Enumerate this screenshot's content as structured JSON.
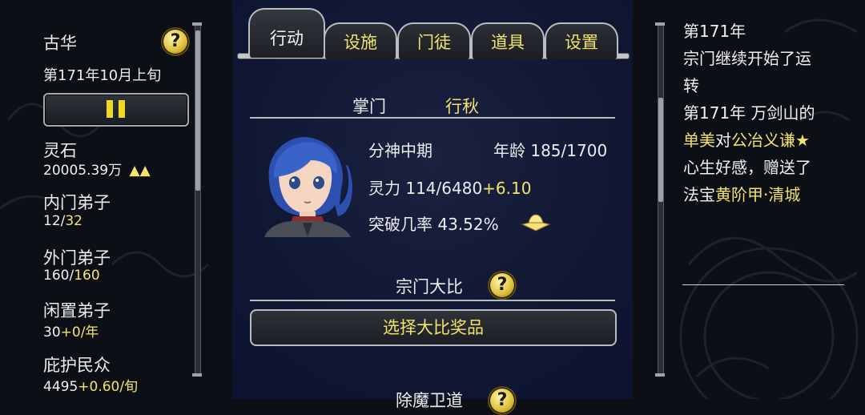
{
  "sidebar": {
    "sect_name": "古华",
    "date": "第171年10月上旬",
    "stats": [
      {
        "label": "灵石",
        "value": "20005.39万",
        "arrows": "▲▲"
      },
      {
        "label": "内门弟子",
        "value_a": "12/",
        "value_b": "32"
      },
      {
        "label": "外门弟子",
        "value_a": "160/",
        "value_b": "160"
      },
      {
        "label": "闲置弟子",
        "value_a": "30",
        "value_b": "+0/年"
      },
      {
        "label": "庇护民众",
        "value_a": "4495",
        "value_b": "+0.60/旬"
      }
    ]
  },
  "tabs": [
    {
      "label": "行动",
      "active": true
    },
    {
      "label": "设施",
      "active": false
    },
    {
      "label": "门徒",
      "active": false
    },
    {
      "label": "道具",
      "active": false
    },
    {
      "label": "设置",
      "active": false
    }
  ],
  "leader": {
    "title_label": "掌门",
    "name": "行秋",
    "realm": "分神中期",
    "age_label": "年龄",
    "age_value": "185/1700",
    "spirit_label": "灵力",
    "spirit_value": "114/6480",
    "spirit_rate": "+6.10",
    "breakthrough_label": "突破几率",
    "breakthrough_value": "43.52%"
  },
  "competition": {
    "title": "宗门大比",
    "button_label": "选择大比奖品",
    "next_title": "除魔卫道"
  },
  "help_glyph": "?",
  "log": {
    "lines": [
      [
        {
          "t": "第171年",
          "c": "white"
        }
      ],
      [
        {
          "t": "宗门继续开始了运",
          "c": "white"
        }
      ],
      [
        {
          "t": "转",
          "c": "white"
        }
      ],
      [
        {
          "t": "第171年 万剑山的",
          "c": "white"
        }
      ],
      [
        {
          "t": "单美",
          "c": "yellow"
        },
        {
          "t": "对",
          "c": "white"
        },
        {
          "t": "公冶义谦★",
          "c": "yellow"
        }
      ],
      [
        {
          "t": "心生好感，赠送了",
          "c": "white"
        }
      ],
      [
        {
          "t": "法宝",
          "c": "white"
        },
        {
          "t": "黄阶甲·清城",
          "c": "yellow"
        }
      ]
    ]
  },
  "colors": {
    "accent_yellow": "#f3e36c",
    "text_white": "#f0f0f0",
    "panel_blue": "#101733"
  },
  "icons": {
    "pause": "pause-icon",
    "help": "question-icon",
    "up_arrows": "double-up-arrow-icon",
    "breakthrough": "lotus-icon"
  }
}
